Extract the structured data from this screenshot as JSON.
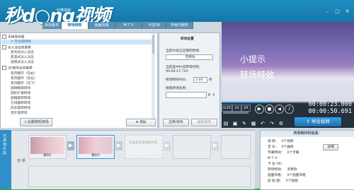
{
  "app": {
    "logo_text": "秒d○ng视频",
    "logo_sub": "秒懂视频",
    "title": "...编软件"
  },
  "tabs": [
    {
      "label": "添加素材"
    },
    {
      "label": "转场特效"
    },
    {
      "label": "画面风格"
    },
    {
      "label": "M T V"
    },
    {
      "label": "卡拉OK"
    },
    {
      "label": "升级与服务"
    }
  ],
  "transition_list": {
    "items": [
      {
        "type": "cat",
        "label": "无转场效果"
      },
      {
        "type": "item",
        "label": "无任何特效",
        "selected": true
      },
      {
        "type": "cat",
        "label": "淡入淡出效果类"
      },
      {
        "type": "item",
        "label": "变亮式淡入淡出"
      },
      {
        "type": "item",
        "label": "变黑式淡入淡出"
      },
      {
        "type": "item",
        "label": "透明式淡入淡出"
      },
      {
        "type": "cat",
        "label": "3D或专业效果类"
      },
      {
        "type": "item",
        "label": "卷页翻开（向右）"
      },
      {
        "type": "item",
        "label": "卷页翻开（向左）"
      },
      {
        "type": "item",
        "label": "卷页翻开（向下）"
      },
      {
        "type": "item",
        "label": "圆球翻滚转场"
      },
      {
        "type": "item",
        "label": "圆形扩散转场"
      },
      {
        "type": "item",
        "label": "圆锥旋转转场"
      },
      {
        "type": "item",
        "label": "方块翻转转场"
      },
      {
        "type": "item",
        "label": "风车旋转转场"
      },
      {
        "type": "item",
        "label": "百叶窗转场"
      }
    ],
    "random_button": "设置随机转场",
    "add_button": "添加"
  },
  "settings": {
    "title": "转场设置",
    "current_label": "当前片段已应用的转场：",
    "current_value": "无特效",
    "time_label": "当前选中片段转场时刻：",
    "time_value": "00:00:27.724",
    "duration_label": "转场特效时长：",
    "duration_value": "2.00",
    "duration_unit": "秒",
    "search_label": "搜索转场名称：",
    "search_value": "",
    "apply_button": "应用/修改",
    "delete_button": "删除转场"
  },
  "preview": {
    "line1": "小提示",
    "line2": "转场特效",
    "progress": 0.36,
    "speed_labels": [
      "1/2X",
      "1X",
      "2X"
    ],
    "time_current": "00:00:23.000",
    "time_total": "00:00:50.691",
    "export_button": "导出视频"
  },
  "timeline": {
    "side_label": "已添加片段",
    "clips": [
      {
        "label": "素材1"
      },
      {
        "label": "素材3"
      },
      {
        "label": "点击此处添加新片段"
      }
    ],
    "track2_label": "音 频"
  },
  "properties": {
    "header": "所有制作的信息：",
    "rows": [
      {
        "key": "视 频：",
        "value": "0个视频"
      },
      {
        "key": "音 乐：",
        "value": "0个曲目",
        "button": "详细"
      },
      {
        "key": "字幕特效：",
        "value": "0个字幕"
      },
      {
        "key": "M T V：",
        "value": ""
      },
      {
        "key": "卡 拉 OK：",
        "value": ""
      },
      {
        "key": "转场特效：",
        "value": "无特效"
      },
      {
        "key": "画面风格：",
        "value": "0个画面风格"
      },
      {
        "key": "加 贴 图：",
        "value": "0个贴图"
      }
    ]
  }
}
